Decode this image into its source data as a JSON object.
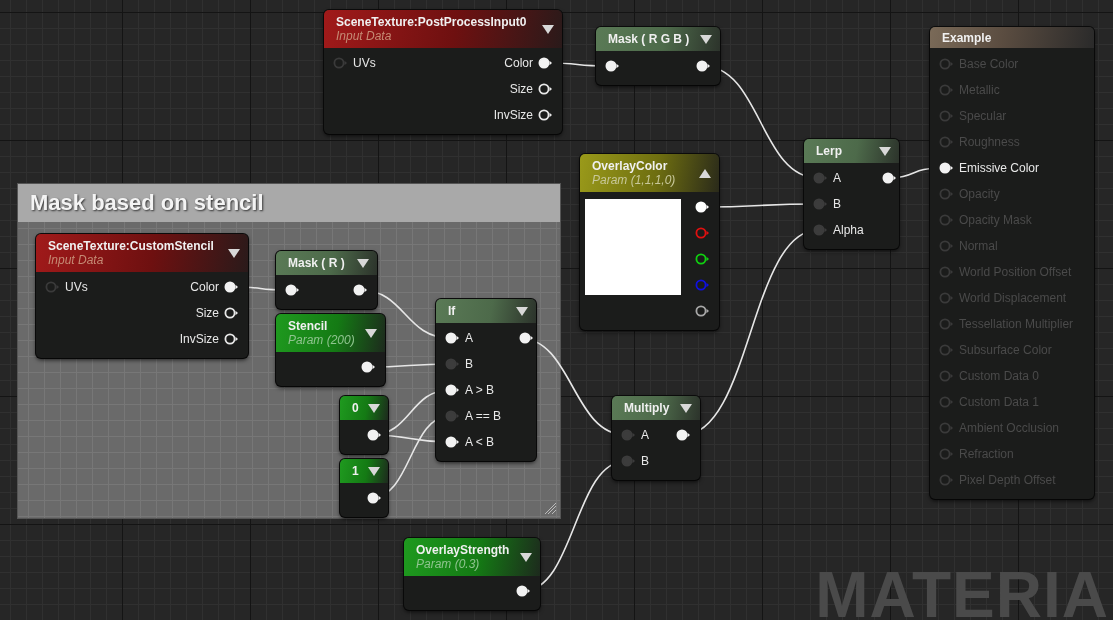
{
  "comment": {
    "title": "Mask based on stencil"
  },
  "nodes": [
    {
      "title": "SceneTexture:PostProcessInput0",
      "subtitle": "Input Data",
      "kind": "texture",
      "expanded": false,
      "inputs": [
        {
          "label": "UVs",
          "kind": "faint"
        }
      ],
      "outputs": [
        {
          "label": "Color",
          "kind": "filled"
        },
        {
          "label": "Size",
          "kind": "hollow"
        },
        {
          "label": "InvSize",
          "kind": "hollow"
        }
      ]
    },
    {
      "title": "Mask ( R G B )",
      "kind": "mask",
      "expanded": false,
      "inputs": [
        {
          "kind": "filled"
        }
      ],
      "outputs": [
        {
          "kind": "filled"
        }
      ]
    },
    {
      "title": "OverlayColor",
      "subtitle": "Param (1,1,1,0)",
      "kind": "vector",
      "expanded": true,
      "color": "#ffffff",
      "outputs": [
        {
          "kind": "filled",
          "color": "#ffffff"
        },
        {
          "kind": "hollow",
          "color": "#e01010"
        },
        {
          "kind": "hollow",
          "color": "#10d010"
        },
        {
          "kind": "hollow",
          "color": "#1010e0"
        },
        {
          "kind": "hollow",
          "color": "#a8a8a8"
        }
      ]
    },
    {
      "title": "Lerp",
      "kind": "mask",
      "expanded": false,
      "inputs": [
        {
          "label": "A",
          "kind": "dim"
        },
        {
          "label": "B",
          "kind": "dim"
        },
        {
          "label": "Alpha",
          "kind": "dim"
        }
      ],
      "outputs": [
        {
          "kind": "filled"
        }
      ]
    },
    {
      "title": "SceneTexture:CustomStencil",
      "subtitle": "Input Data",
      "kind": "texture",
      "expanded": false,
      "inputs": [
        {
          "label": "UVs",
          "kind": "faint"
        }
      ],
      "outputs": [
        {
          "label": "Color",
          "kind": "filled"
        },
        {
          "label": "Size",
          "kind": "hollow"
        },
        {
          "label": "InvSize",
          "kind": "hollow"
        }
      ]
    },
    {
      "title": "Mask ( R )",
      "kind": "mask",
      "expanded": false,
      "inputs": [
        {
          "kind": "filled"
        }
      ],
      "outputs": [
        {
          "kind": "filled"
        }
      ]
    },
    {
      "title": "Stencil",
      "subtitle": "Param (200)",
      "kind": "param",
      "expanded": false,
      "outputs": [
        {
          "kind": "filled"
        }
      ]
    },
    {
      "title": "If",
      "kind": "mask",
      "expanded": false,
      "inputs": [
        {
          "label": "A",
          "kind": "filled"
        },
        {
          "label": "B",
          "kind": "dim"
        },
        {
          "label": "A > B",
          "kind": "filled"
        },
        {
          "label": "A == B",
          "kind": "dim"
        },
        {
          "label": "A < B",
          "kind": "filled"
        }
      ],
      "outputs": [
        {
          "kind": "filled"
        }
      ]
    },
    {
      "title": "0",
      "kind": "param",
      "expanded": false,
      "outputs": [
        {
          "kind": "filled"
        }
      ]
    },
    {
      "title": "1",
      "kind": "param",
      "expanded": false,
      "outputs": [
        {
          "kind": "filled"
        }
      ]
    },
    {
      "title": "Multiply",
      "kind": "mask",
      "expanded": false,
      "inputs": [
        {
          "label": "A",
          "kind": "dim"
        },
        {
          "label": "B",
          "kind": "dim"
        }
      ],
      "outputs": [
        {
          "kind": "filled"
        }
      ]
    },
    {
      "title": "OverlayStrength",
      "subtitle": "Param (0.3)",
      "kind": "param",
      "expanded": false,
      "outputs": [
        {
          "kind": "filled"
        }
      ]
    }
  ],
  "output_node": {
    "title": "Example",
    "pins": [
      {
        "label": "Base Color",
        "active": false
      },
      {
        "label": "Metallic",
        "active": false
      },
      {
        "label": "Specular",
        "active": false
      },
      {
        "label": "Roughness",
        "active": false
      },
      {
        "label": "Emissive Color",
        "active": true
      },
      {
        "label": "Opacity",
        "active": false
      },
      {
        "label": "Opacity Mask",
        "active": false
      },
      {
        "label": "Normal",
        "active": false
      },
      {
        "label": "World Position Offset",
        "active": false
      },
      {
        "label": "World Displacement",
        "active": false
      },
      {
        "label": "Tessellation Multiplier",
        "active": false
      },
      {
        "label": "Subsurface Color",
        "active": false
      },
      {
        "label": "Custom Data 0",
        "active": false
      },
      {
        "label": "Custom Data 1",
        "active": false
      },
      {
        "label": "Ambient Occlusion",
        "active": false
      },
      {
        "label": "Refraction",
        "active": false
      },
      {
        "label": "Pixel Depth Offset",
        "active": false
      }
    ]
  },
  "watermark": "MATERIA"
}
